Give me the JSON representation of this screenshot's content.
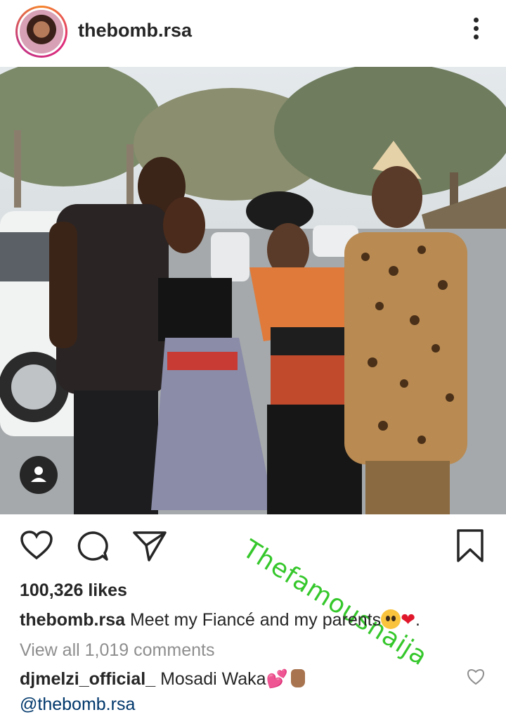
{
  "post": {
    "username": "thebomb.rsa",
    "likes": "100,326 likes",
    "caption_user": "thebomb.rsa",
    "caption_text": "Meet my Fiancé and my parents",
    "caption_end": ".",
    "view_all": "View all 1,019 comments",
    "watermark": "Thefamousnaija"
  },
  "comment": {
    "user": "djmelzi_official_",
    "text": "Mosadi Waka",
    "mention": "@thebomb.rsa"
  },
  "icons": {
    "more": "more-vertical-icon",
    "like": "heart-outline-icon",
    "comment": "comment-bubble-icon",
    "share": "paper-plane-icon",
    "save": "bookmark-icon",
    "user_tag": "person-icon"
  }
}
